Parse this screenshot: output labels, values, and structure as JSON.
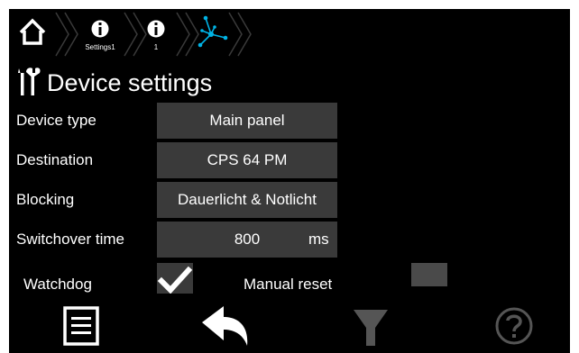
{
  "breadcrumb": {
    "items": [
      {
        "icon": "home-icon",
        "label": ""
      },
      {
        "icon": "info-icon",
        "label": "Settings1"
      },
      {
        "icon": "info-icon",
        "label": "1"
      },
      {
        "icon": "network-icon",
        "label": ""
      }
    ]
  },
  "page": {
    "title": "Device settings",
    "title_icon": "settings-tools-icon"
  },
  "settings": {
    "device_type": {
      "label": "Device type",
      "value": "Main panel"
    },
    "destination": {
      "label": "Destination",
      "value": "CPS 64 PM"
    },
    "blocking": {
      "label": "Blocking",
      "value": "Dauerlicht & Notlicht"
    },
    "switchover_time": {
      "label": "Switchover time",
      "value": "800",
      "unit": "ms"
    },
    "watchdog": {
      "label": "Watchdog",
      "checked": true
    },
    "manual_reset": {
      "label": "Manual reset",
      "checked": false
    }
  },
  "toolbar": {
    "items": [
      "menu-icon",
      "back-icon",
      "filter-icon",
      "help-icon"
    ]
  },
  "colors": {
    "background": "#000000",
    "field": "#3a3a3a",
    "text": "#ffffff",
    "network_icon": "#00b4e6",
    "disabled_icon": "#555555"
  }
}
